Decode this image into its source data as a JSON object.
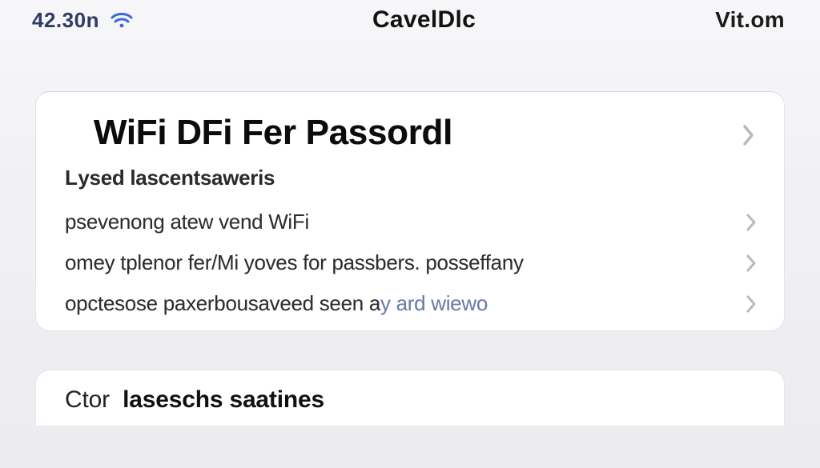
{
  "statusbar": {
    "time": "42.30n",
    "title": "CavelDlc",
    "right": "Vit.om"
  },
  "card": {
    "title": "WiFi DFi Fer Passordl",
    "section_label_caps": "L",
    "section_label_rest": "ysed lascentsaweris",
    "rows": [
      {
        "text": "psevenong atew vend WiFi",
        "link": ""
      },
      {
        "text": "omey tplenor fer/Mi yoves for passbers. posseffany",
        "link": ""
      },
      {
        "text": "opctesose paxerbousaveed seen a",
        "link": "y ard wiewo"
      }
    ]
  },
  "card2": {
    "lead": "Ctor",
    "rest": "laseschs saatines"
  },
  "icons": {
    "wifi": "wifi-icon",
    "chevron": "chevron-right-icon"
  }
}
